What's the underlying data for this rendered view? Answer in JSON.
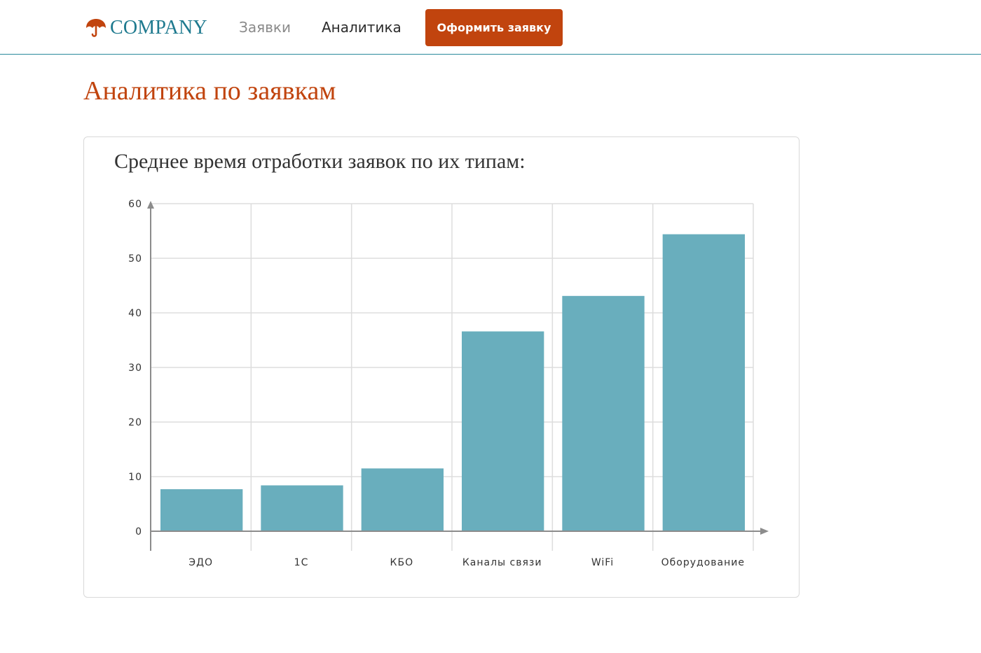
{
  "header": {
    "brand_name": "COMPANY",
    "brand_icon": "umbrella-icon",
    "nav": {
      "requests": "Заявки",
      "analytics": "Аналитика"
    },
    "cta_label": "Оформить заявку"
  },
  "page": {
    "title": "Аналитика по заявкам"
  },
  "card": {
    "title": "Среднее время отработки заявок по их типам:"
  },
  "colors": {
    "accent": "#c1440e",
    "brand": "#1f7a8f",
    "bar": "#69aebd",
    "header_border": "#2a8a9c"
  },
  "chart_data": {
    "type": "bar",
    "title": "",
    "xlabel": "",
    "ylabel": "",
    "categories": [
      "ЭДО",
      "1С",
      "КБО",
      "Каналы связи",
      "WiFi",
      "Оборудование"
    ],
    "values": [
      7.7,
      8.4,
      11.5,
      36.6,
      43.1,
      54.4
    ],
    "ylim": [
      0,
      60
    ],
    "yticks": [
      0,
      10,
      20,
      30,
      40,
      50,
      60
    ],
    "grid": true,
    "legend": "none",
    "bar_color": "#69aebd"
  }
}
